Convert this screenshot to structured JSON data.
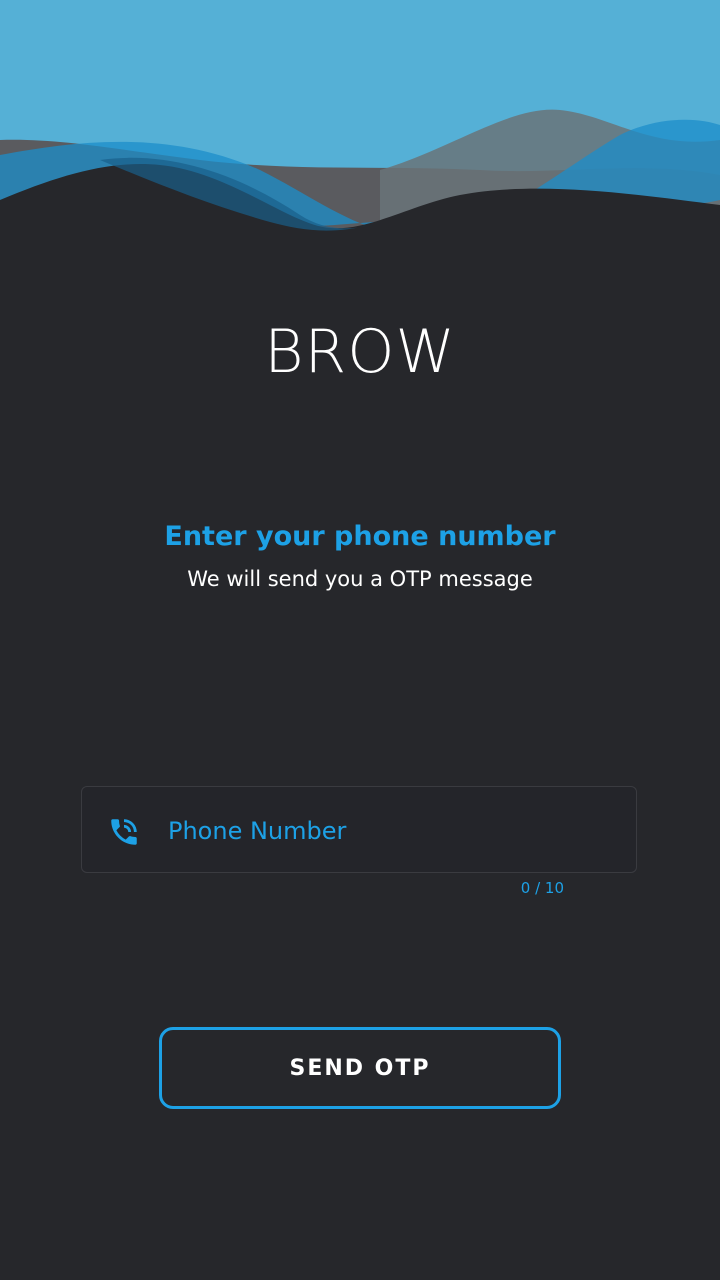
{
  "app": {
    "title": "BROW"
  },
  "prompt": {
    "heading": "Enter your phone number",
    "subheading": "We will send you a OTP message"
  },
  "phone_field": {
    "icon": "phone-in-talk-icon",
    "placeholder": "Phone Number",
    "value": "",
    "counter": "0 / 10"
  },
  "actions": {
    "send_label": "SEND OTP"
  },
  "colors": {
    "background": "#26272b",
    "accent": "#1da1e6",
    "wave_light": "#55b0d6",
    "wave_mid": "#2a93c8",
    "wave_grey": "#5e5f63",
    "text": "#ffffff"
  }
}
